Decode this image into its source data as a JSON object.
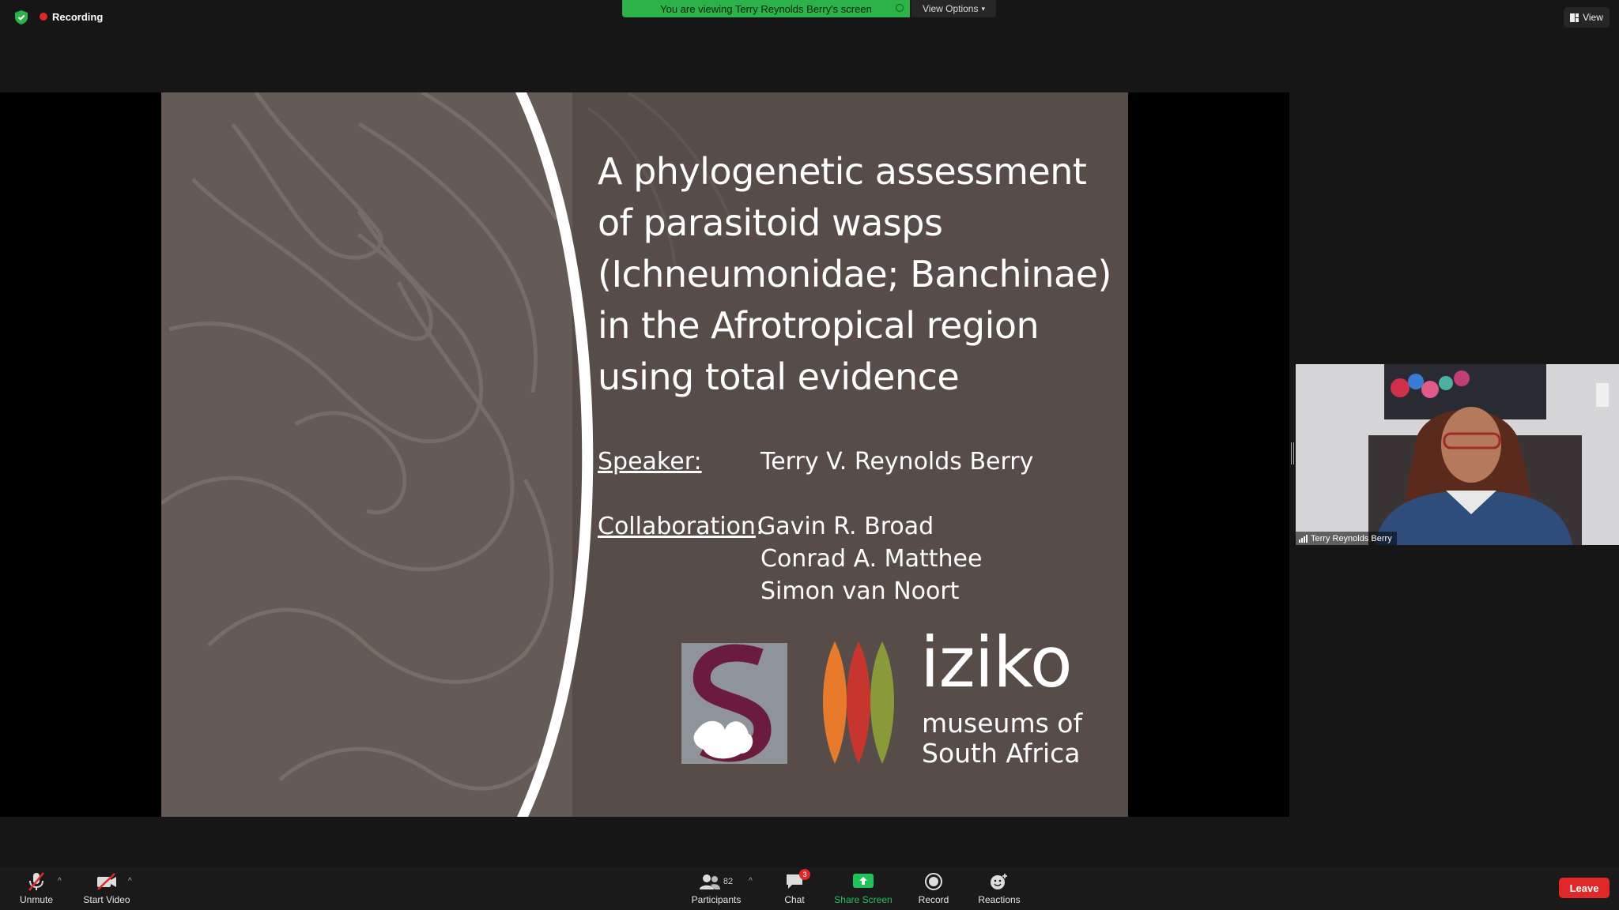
{
  "top_bar": {
    "recording_label": "Recording",
    "viewing_banner": "You are viewing Terry Reynolds Berry's screen",
    "view_options_label": "View Options",
    "view_button_label": "View"
  },
  "slide": {
    "title_lines": [
      "A phylogenetic assessment",
      "of parasitoid wasps",
      "(Ichneumonidae; Banchinae)",
      "in the Afrotropical region",
      "using total evidence"
    ],
    "speaker_label": "Speaker:",
    "speaker_name": "Terry V. Reynolds Berry",
    "collaboration_label": "Collaboration",
    "collaborators": [
      "Gavin R. Broad",
      "Conrad A. Matthee",
      "Simon van Noort"
    ],
    "logo_wordmark": "iziko",
    "logo_sub_lines": [
      "museums of",
      "South Africa"
    ]
  },
  "video": {
    "participant_name": "Terry Reynolds Berry"
  },
  "toolbar": {
    "unmute_label": "Unmute",
    "start_video_label": "Start Video",
    "participants_label": "Participants",
    "participants_count": "82",
    "chat_label": "Chat",
    "chat_badge": "3",
    "share_screen_label": "Share Screen",
    "record_label": "Record",
    "reactions_label": "Reactions",
    "leave_label": "Leave"
  },
  "colors": {
    "banner_green": "#2bb34a",
    "leave_red": "#e02828",
    "slide_bg": "#574c48",
    "share_green": "#22c25a"
  }
}
